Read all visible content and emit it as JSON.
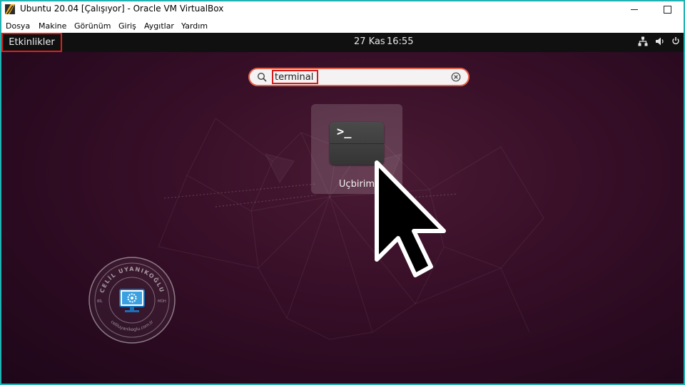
{
  "window": {
    "title": "Ubuntu 20.04 [Çalışıyor] - Oracle VM VirtualBox"
  },
  "menubar": {
    "items": [
      "Dosya",
      "Makine",
      "Görünüm",
      "Giriş",
      "Aygıtlar",
      "Yardım"
    ]
  },
  "topbar": {
    "activities_label": "Etkinlikler",
    "date": "27 Kas",
    "time": "16:55"
  },
  "search": {
    "value": "terminal"
  },
  "results": [
    {
      "label": "Uçbirim",
      "icon": "terminal-icon",
      "prompt": ">_"
    }
  ],
  "logo": {
    "name": "CELİL UYANIKOĞLU",
    "left_tag": "BİL",
    "right_tag": "MÜH",
    "url": "celiluyanikoglu.com.tr"
  },
  "colors": {
    "frame_border": "#1fb3b3",
    "highlight_red": "#d31e1e",
    "search_border": "#e5624a",
    "topbar_bg": "#101010"
  }
}
